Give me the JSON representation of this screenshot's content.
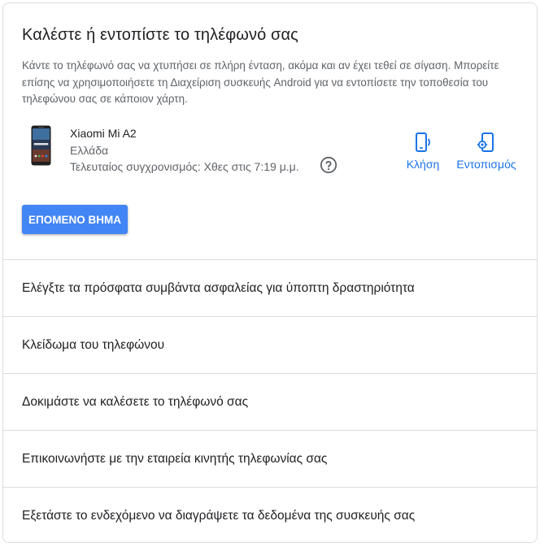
{
  "card": {
    "title": "Καλέστε ή εντοπίστε το τηλέφωνό σας",
    "description": "Κάντε το τηλέφωνό σας να χτυπήσει σε πλήρη ένταση, ακόμα και αν έχει τεθεί σε σίγαση. Μπορείτε επίσης να χρησιμοποιήσετε τη Διαχείριση συσκευής Android για να εντοπίσετε την τοποθεσία του τηλεφώνου σας σε κάποιον χάρτη."
  },
  "device": {
    "name": "Xiaomi Mi A2",
    "country": "Ελλάδα",
    "last_sync": "Τελευταίος συγχρονισμός: Χθες στις 7:19 μ.μ.",
    "icon": "smartphone-image"
  },
  "actions": {
    "call_label": "Κλήση",
    "call_icon": "phone-ring-icon",
    "locate_label": "Εντοπισμός",
    "locate_icon": "locate-phone-icon",
    "help_icon": "help-circle-icon"
  },
  "next_button": {
    "label": "ΕΠΟΜΕΝΟ ΒΗΜΑ"
  },
  "list": {
    "items": [
      "Ελέγξτε τα πρόσφατα συμβάντα ασφαλείας για ύποπτη δραστηριότητα",
      "Κλείδωμα του τηλεφώνου",
      "Δοκιμάστε να καλέσετε το τηλέφωνό σας",
      "Επικοινωνήστε με την εταιρεία κινητής τηλεφωνίας σας",
      "Εξετάστε το ενδεχόμενο να διαγράψετε τα δεδομένα της συσκευής σας"
    ]
  },
  "colors": {
    "accent": "#1a73e8",
    "button": "#4285f4",
    "text_primary": "#202124",
    "text_secondary": "#5f6368",
    "divider": "#dadce0"
  }
}
